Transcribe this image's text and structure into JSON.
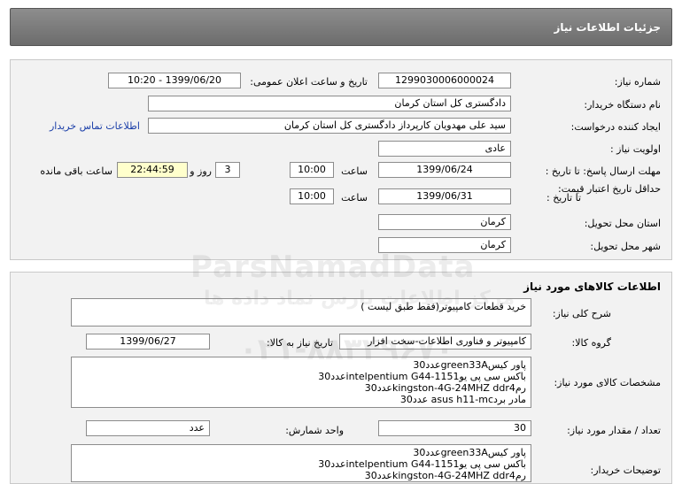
{
  "header": {
    "title": "جزئیات اطلاعات نیاز"
  },
  "info": {
    "need_number_label": "شماره نیاز:",
    "need_number": "1299030006000024",
    "announce_label": "تاریخ و ساعت اعلان عمومی:",
    "announce_value": "1399/06/20 - 10:20",
    "buyer_org_label": "نام دستگاه خریدار:",
    "buyer_org": "دادگستری کل استان کرمان",
    "requester_label": "ایجاد کننده درخواست:",
    "requester": "سید علی مهدویان کارپرداز دادگستری کل استان کرمان",
    "contact_link": "اطلاعات تماس خریدار",
    "priority_label": "اولویت نیاز :",
    "priority": "عادی",
    "deadline_label": "مهلت ارسال پاسخ: تا تاریخ :",
    "deadline_date": "1399/06/24",
    "time_label": "ساعت",
    "deadline_time": "10:00",
    "days_value": "3",
    "days_label": "روز و",
    "remaining_time": "22:44:59",
    "remaining_label": "ساعت باقی مانده",
    "validity_label": "حداقل تاریخ اعتبار قیمت:",
    "validity_to_label": "تا تاریخ :",
    "validity_date": "1399/06/31",
    "validity_time": "10:00",
    "province_label": "استان محل تحویل:",
    "province": "کرمان",
    "city_label": "شهر محل تحویل:",
    "city": "کرمان"
  },
  "goods": {
    "title": "اطلاعات کالاهای مورد نیاز",
    "desc_label": "شرح کلی نیاز:",
    "desc": "خرید قطعات کامپیوتر(فقط طبق لیست )",
    "group_label": "گروه کالا:",
    "group": "کامپیوتر و فناوری اطلاعات-سخت افزار",
    "need_date_label": "تاریخ نیاز به کالا:",
    "need_date": "1399/06/27",
    "spec_label": "مشخصات کالای مورد نیاز:",
    "spec": "پاور کیسgreen33Aعدد30\nباکس سی پی یوintelpentium G44-1151عدد30\nرمkingston-4G-24MHZ   ddr4عدد30\nمادر بردasus h11-mc  عدد30",
    "qty_label": "تعداد / مقدار مورد نیاز:",
    "qty": "30",
    "unit_label": "واحد شمارش:",
    "unit": "عدد",
    "buyer_notes_label": "توضیحات خریدار:",
    "buyer_notes": "پاور کیسgreen33Aعدد30\nباکس سی پی یوintelpentium G44-1151عدد30\nرمkingston-4G-24MHZ   ddr4عدد30"
  },
  "watermark": {
    "brand": "ParsNamadData",
    "line1": "مرکز اطلاعات پارس نماد داده ها",
    "phone": "۰۲۱-۸۸۳۴۹۶۷۰"
  }
}
